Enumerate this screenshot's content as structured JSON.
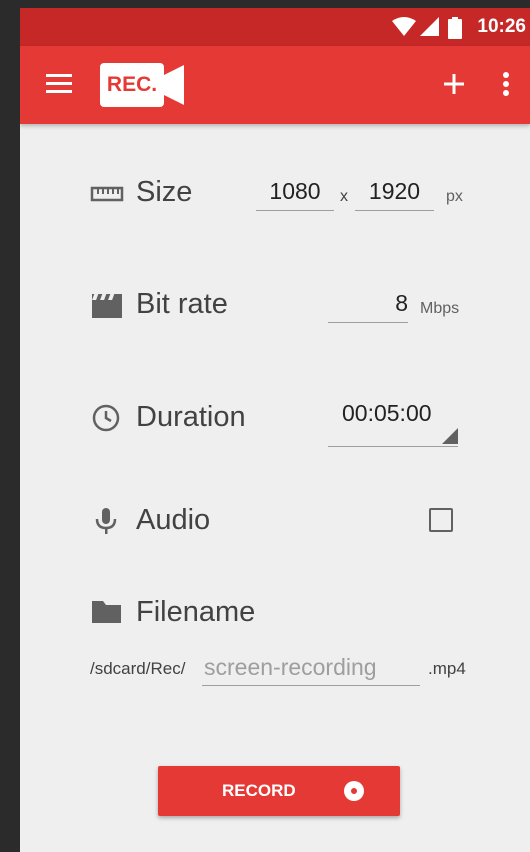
{
  "status_bar": {
    "time": "10:26",
    "icons": [
      "wifi-icon",
      "signal-icon",
      "battery-icon"
    ]
  },
  "app_bar": {
    "logo_text": "REC.",
    "actions": [
      "menu-icon",
      "add-icon",
      "more-vert-icon"
    ]
  },
  "size": {
    "label": "Size",
    "width": "1080",
    "separator": "x",
    "height": "1920",
    "unit": "px"
  },
  "bitrate": {
    "label": "Bit rate",
    "value": "8",
    "unit": "Mbps"
  },
  "duration": {
    "label": "Duration",
    "value": "00:05:00"
  },
  "audio": {
    "label": "Audio",
    "checked": false
  },
  "filename": {
    "label": "Filename",
    "prefix": "/sdcard/Rec/",
    "placeholder": "screen-recording",
    "extension": ".mp4"
  },
  "record_button": {
    "label": "RECORD"
  },
  "colors": {
    "status_bar": "#c62828",
    "app_bar": "#e53935",
    "background": "#efefef",
    "accent": "#e53935"
  }
}
